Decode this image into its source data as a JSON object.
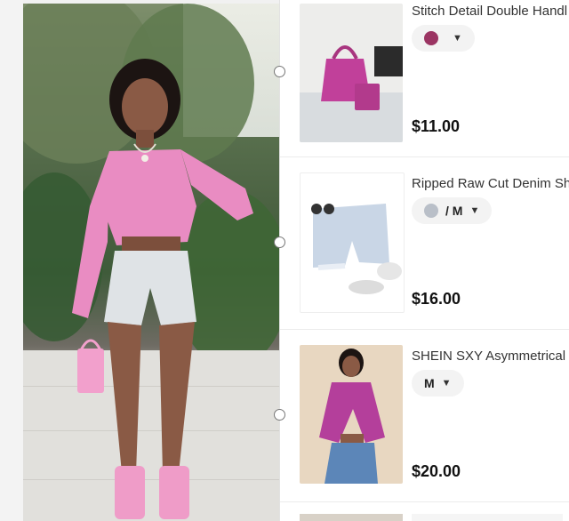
{
  "products": [
    {
      "title": "Stitch Detail Double Handl",
      "option": "",
      "swatch_color": "#b3457a",
      "price": "$11.00",
      "thumb": "bag-image"
    },
    {
      "title": "Ripped Raw Cut Denim Sh",
      "option": "/ M",
      "swatch_color": "#b9bfc8",
      "price": "$16.00",
      "thumb": "shorts-image"
    },
    {
      "title": "SHEIN SXY Asymmetrical I",
      "option": "M",
      "swatch_color": "",
      "price": "$20.00",
      "thumb": "top-image"
    }
  ],
  "colors": {
    "accent_pink": "#e88fc0",
    "bag_purple": "#c1409a"
  }
}
